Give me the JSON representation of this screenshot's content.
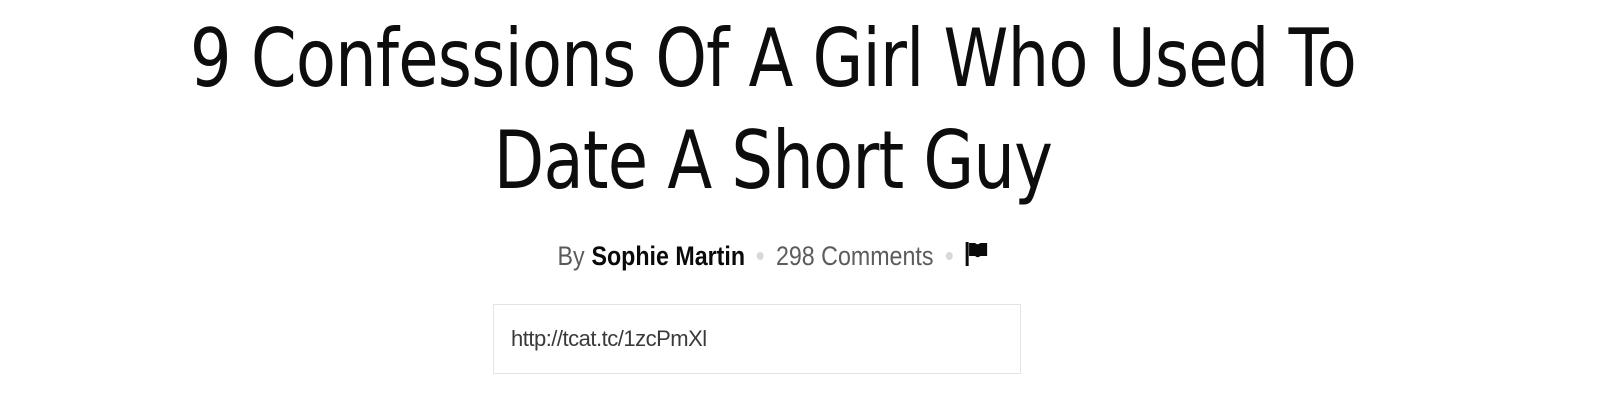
{
  "article": {
    "title": "9 Confessions Of A Girl Who Used To Date A Short Guy",
    "byline": {
      "prefix": "By",
      "author": "Sophie Martin",
      "comments": "298 Comments",
      "flag_icon": "flag-icon"
    },
    "share": {
      "url": "http://tcat.tc/1zcPmXl"
    }
  },
  "colors": {
    "text": "#0d0d0d",
    "muted": "#5a5a5a",
    "separator": "#d8d8d8",
    "border": "#e3e3e3"
  }
}
